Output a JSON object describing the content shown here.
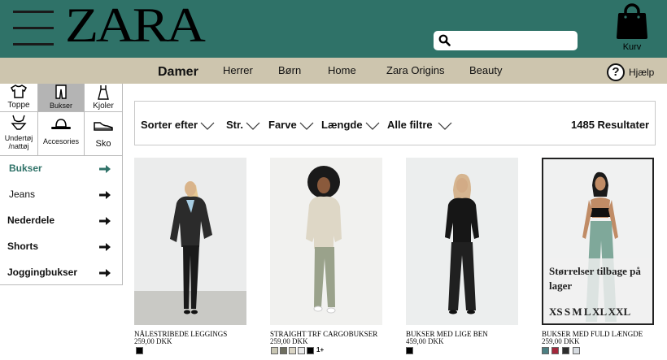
{
  "header": {
    "logo": "ZARA",
    "search_placeholder": "",
    "cart_label": "Kurv"
  },
  "nav": {
    "items": [
      "Damer",
      "Herrer",
      "Børn",
      "Home",
      "Zara Origins",
      "Beauty"
    ],
    "active": "Damer",
    "help_label": "Hjælp"
  },
  "categories": {
    "selected": "Bukser",
    "items": [
      {
        "label": "Toppe",
        "icon": "top-icon"
      },
      {
        "label": "Bukser",
        "icon": "pants-icon"
      },
      {
        "label": "Kjoler",
        "icon": "dress-icon"
      },
      {
        "label": "Undertøj /nattøj",
        "icon": "lingerie-icon"
      },
      {
        "label": "Accesories",
        "icon": "hat-icon"
      },
      {
        "label": "Sko",
        "icon": "shoe-icon"
      }
    ]
  },
  "subcategories": {
    "selected": "Bukser",
    "items": [
      "Bukser",
      "Jeans",
      "Nederdele",
      "Shorts",
      "Joggingbukser"
    ]
  },
  "filters": {
    "items": [
      "Sorter efter",
      "Str.",
      "Farve",
      "Længde",
      "Alle filtre"
    ],
    "results": "1485 Resultater"
  },
  "products": [
    {
      "name": "NÅLESTRIBEDE LEGGINGS",
      "price": "259,00 DKK",
      "swatches": [
        "#000000"
      ],
      "more": ""
    },
    {
      "name": "STRAIGHT TRF CARGOBUKSER",
      "price": "259,00 DKK",
      "swatches": [
        "#c7c5b2",
        "#6f6f60",
        "#d9d4c4",
        "#e9e9e9",
        "#000000"
      ],
      "more": "1+"
    },
    {
      "name": "BUKSER MED LIGE BEN",
      "price": "459,00 DKK",
      "swatches": [
        "#000000"
      ],
      "more": ""
    },
    {
      "name": "BUKSER MED FULD LÆNGDE",
      "price": "259,00 DKK",
      "swatches": [
        "#4c7f82",
        "#a3273b",
        "#2e2e2e",
        "#d6dbe0"
      ],
      "more": ""
    }
  ],
  "size_overlay": {
    "message": "Størrelser tilbage på lager",
    "sizes": "XS S M L XL XXL"
  },
  "colors": {
    "header_bg": "#2f7268",
    "nav_bg": "#cdc5ae",
    "accent_arrow": "#2f7268"
  }
}
